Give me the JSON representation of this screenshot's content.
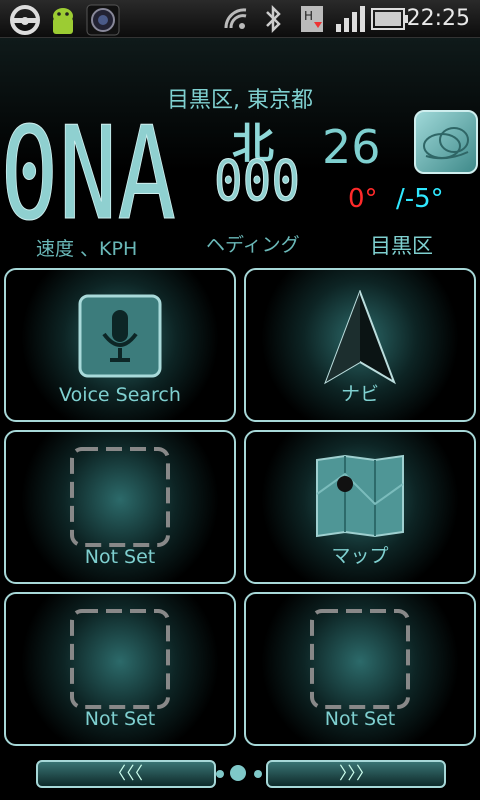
{
  "status_bar": {
    "time": "22:25",
    "icons": [
      "steering-wheel-icon",
      "android-icon",
      "camera-icon",
      "wifi-off-icon",
      "bluetooth-icon",
      "hsdpa-icon",
      "signal-icon",
      "battery-icon"
    ]
  },
  "header": {
    "location": "目黒区, 東京都",
    "speed_value": "0NA",
    "speed_label": "速度 、KPH",
    "heading_char": "北",
    "heading_value": "000",
    "heading_label": "ヘディング",
    "temperature_current": "26",
    "temp_high": "0°",
    "temp_low": "/-5°",
    "weather_place": "目黒区",
    "colors": {
      "high": "#ff2a2a",
      "low": "#30e8ff",
      "accent": "#7fd0d0"
    }
  },
  "tiles": [
    {
      "label": "Voice Search",
      "icon": "microphone-icon"
    },
    {
      "label": "ナビ",
      "icon": "navigation-arrow-icon"
    },
    {
      "label": "Not Set",
      "icon": "empty-slot-icon"
    },
    {
      "label": "マップ",
      "icon": "map-icon"
    },
    {
      "label": "Not Set",
      "icon": "empty-slot-icon"
    },
    {
      "label": "Not Set",
      "icon": "empty-slot-icon"
    }
  ],
  "pager": {
    "prev_label": "〈〈〈",
    "next_label": "〉〉〉"
  }
}
